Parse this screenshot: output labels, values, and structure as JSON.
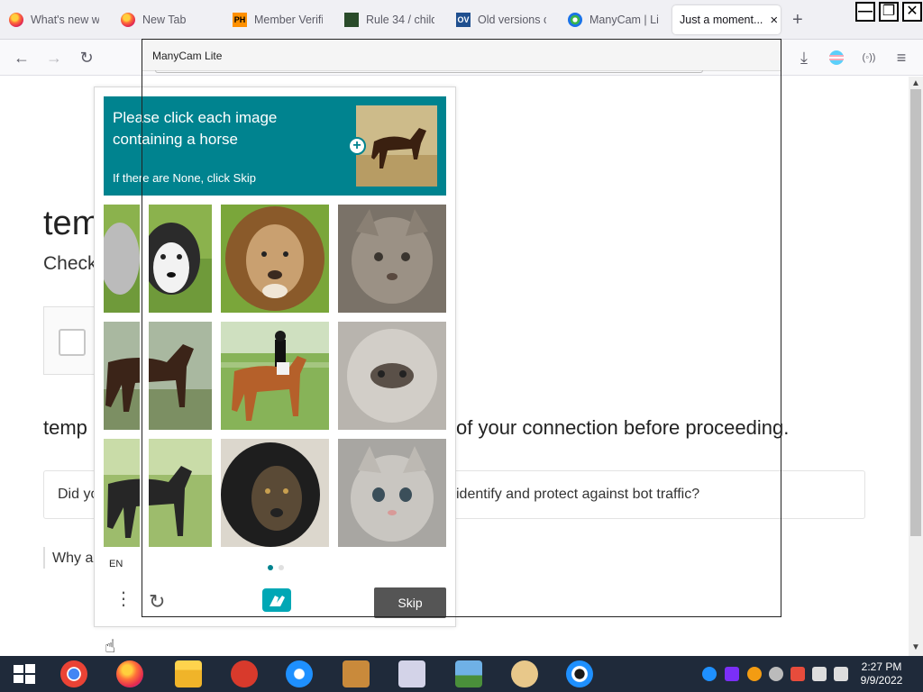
{
  "tabs": [
    {
      "label": "What's new wi",
      "favicon": "firefox-icon"
    },
    {
      "label": "New Tab",
      "favicon": "firefox-icon"
    },
    {
      "label": "Member Verifi",
      "favicon": "ph-icon"
    },
    {
      "label": "Rule 34 / child",
      "favicon": "r34-icon"
    },
    {
      "label": "Old versions c",
      "favicon": "ov-icon"
    },
    {
      "label": "ManyCam | Li",
      "favicon": "manycam-icon"
    },
    {
      "label": "Just a moment...",
      "favicon": "none",
      "active": true
    }
  ],
  "favicon_text": {
    "ph": "PH",
    "ov": "OV"
  },
  "new_tab_symbol": "+",
  "window_controls": {
    "minimize": "—",
    "restore": "❐",
    "close": "✕"
  },
  "toolbar": {
    "back": "←",
    "forward": "→",
    "reload": "↻",
    "download": "⤓",
    "menu": "≡",
    "extension": "(◦))"
  },
  "manycam": {
    "title": "ManyCam Lite"
  },
  "page": {
    "heading_partial": "tem",
    "subheading_partial": "Check",
    "line_left": "temp",
    "line_right": "of your connection before proceeding.",
    "question_left": "Did yo",
    "question_right": "identify and protect against bot traffic?",
    "why": "Why ar"
  },
  "captcha": {
    "prompt": "Please click each image containing a horse",
    "hint": "If there are None, click Skip",
    "plus": "+",
    "language": "EN",
    "skip": "Skip",
    "menu_glyph": "⋮",
    "refresh_glyph": "↻",
    "grid": [
      {
        "row": 1,
        "col": 1,
        "subject": "husky-dog"
      },
      {
        "row": 1,
        "col": 2,
        "subject": "lion"
      },
      {
        "row": 1,
        "col": 3,
        "subject": "cat"
      },
      {
        "row": 2,
        "col": 1,
        "subject": "horse"
      },
      {
        "row": 2,
        "col": 2,
        "subject": "horse-with-rider"
      },
      {
        "row": 2,
        "col": 3,
        "subject": "cat"
      },
      {
        "row": 3,
        "col": 1,
        "subject": "horse"
      },
      {
        "row": 3,
        "col": 2,
        "subject": "black-lion"
      },
      {
        "row": 3,
        "col": 3,
        "subject": "kitten"
      }
    ],
    "page_count": 2,
    "current_page": 1
  },
  "colors": {
    "captcha_teal": "#00838f",
    "taskbar": "#1f2a3a",
    "skip_button": "#555555"
  },
  "taskbar": {
    "apps": [
      "chrome-icon",
      "firefox-icon",
      "file-explorer-icon",
      "p-app-icon",
      "internet-explorer-icon",
      "paint-app-icon",
      "scissors-icon",
      "photo-viewer-icon",
      "palette-icon",
      "manycam-icon"
    ],
    "tray": [
      "webcam-icon",
      "manycam-tray-icon",
      "search-tray-icon",
      "minus-tray-icon",
      "flag-icon",
      "network-icon",
      "volume-icon"
    ],
    "time": "2:27 PM",
    "date": "9/9/2022"
  }
}
